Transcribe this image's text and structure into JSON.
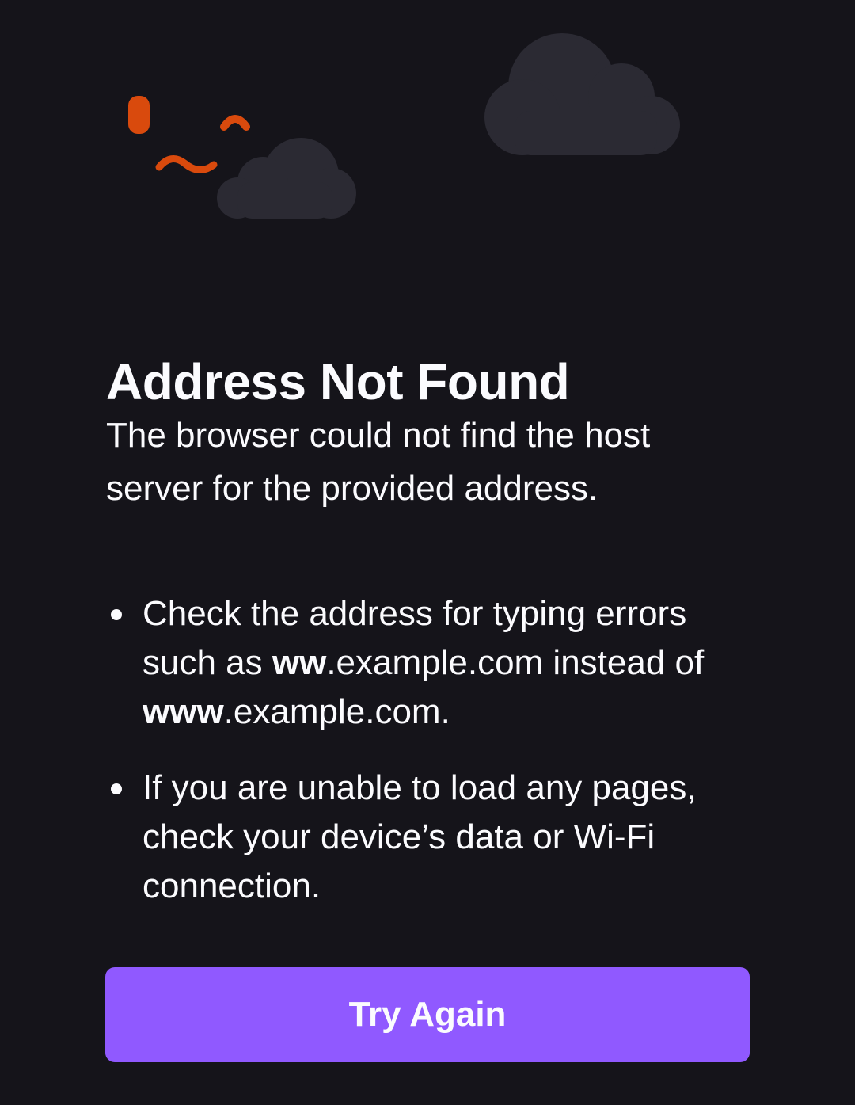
{
  "illustration": {
    "cloud_color": "#2b2a33",
    "accent_color": "#d94a0d"
  },
  "error": {
    "title": "Address Not Found",
    "description": "The browser could not find the host server for the provided address.",
    "tips": [
      {
        "prefix": "Check the address for typing errors such as ",
        "bold1": "ww",
        "middle": ".example.com instead of ",
        "bold2": "www",
        "suffix": ".example.com."
      },
      {
        "text": "If you are unable to load any pages, check your device’s data or Wi-Fi connection."
      }
    ]
  },
  "actions": {
    "try_again_label": "Try Again",
    "button_color": "#9059ff"
  }
}
